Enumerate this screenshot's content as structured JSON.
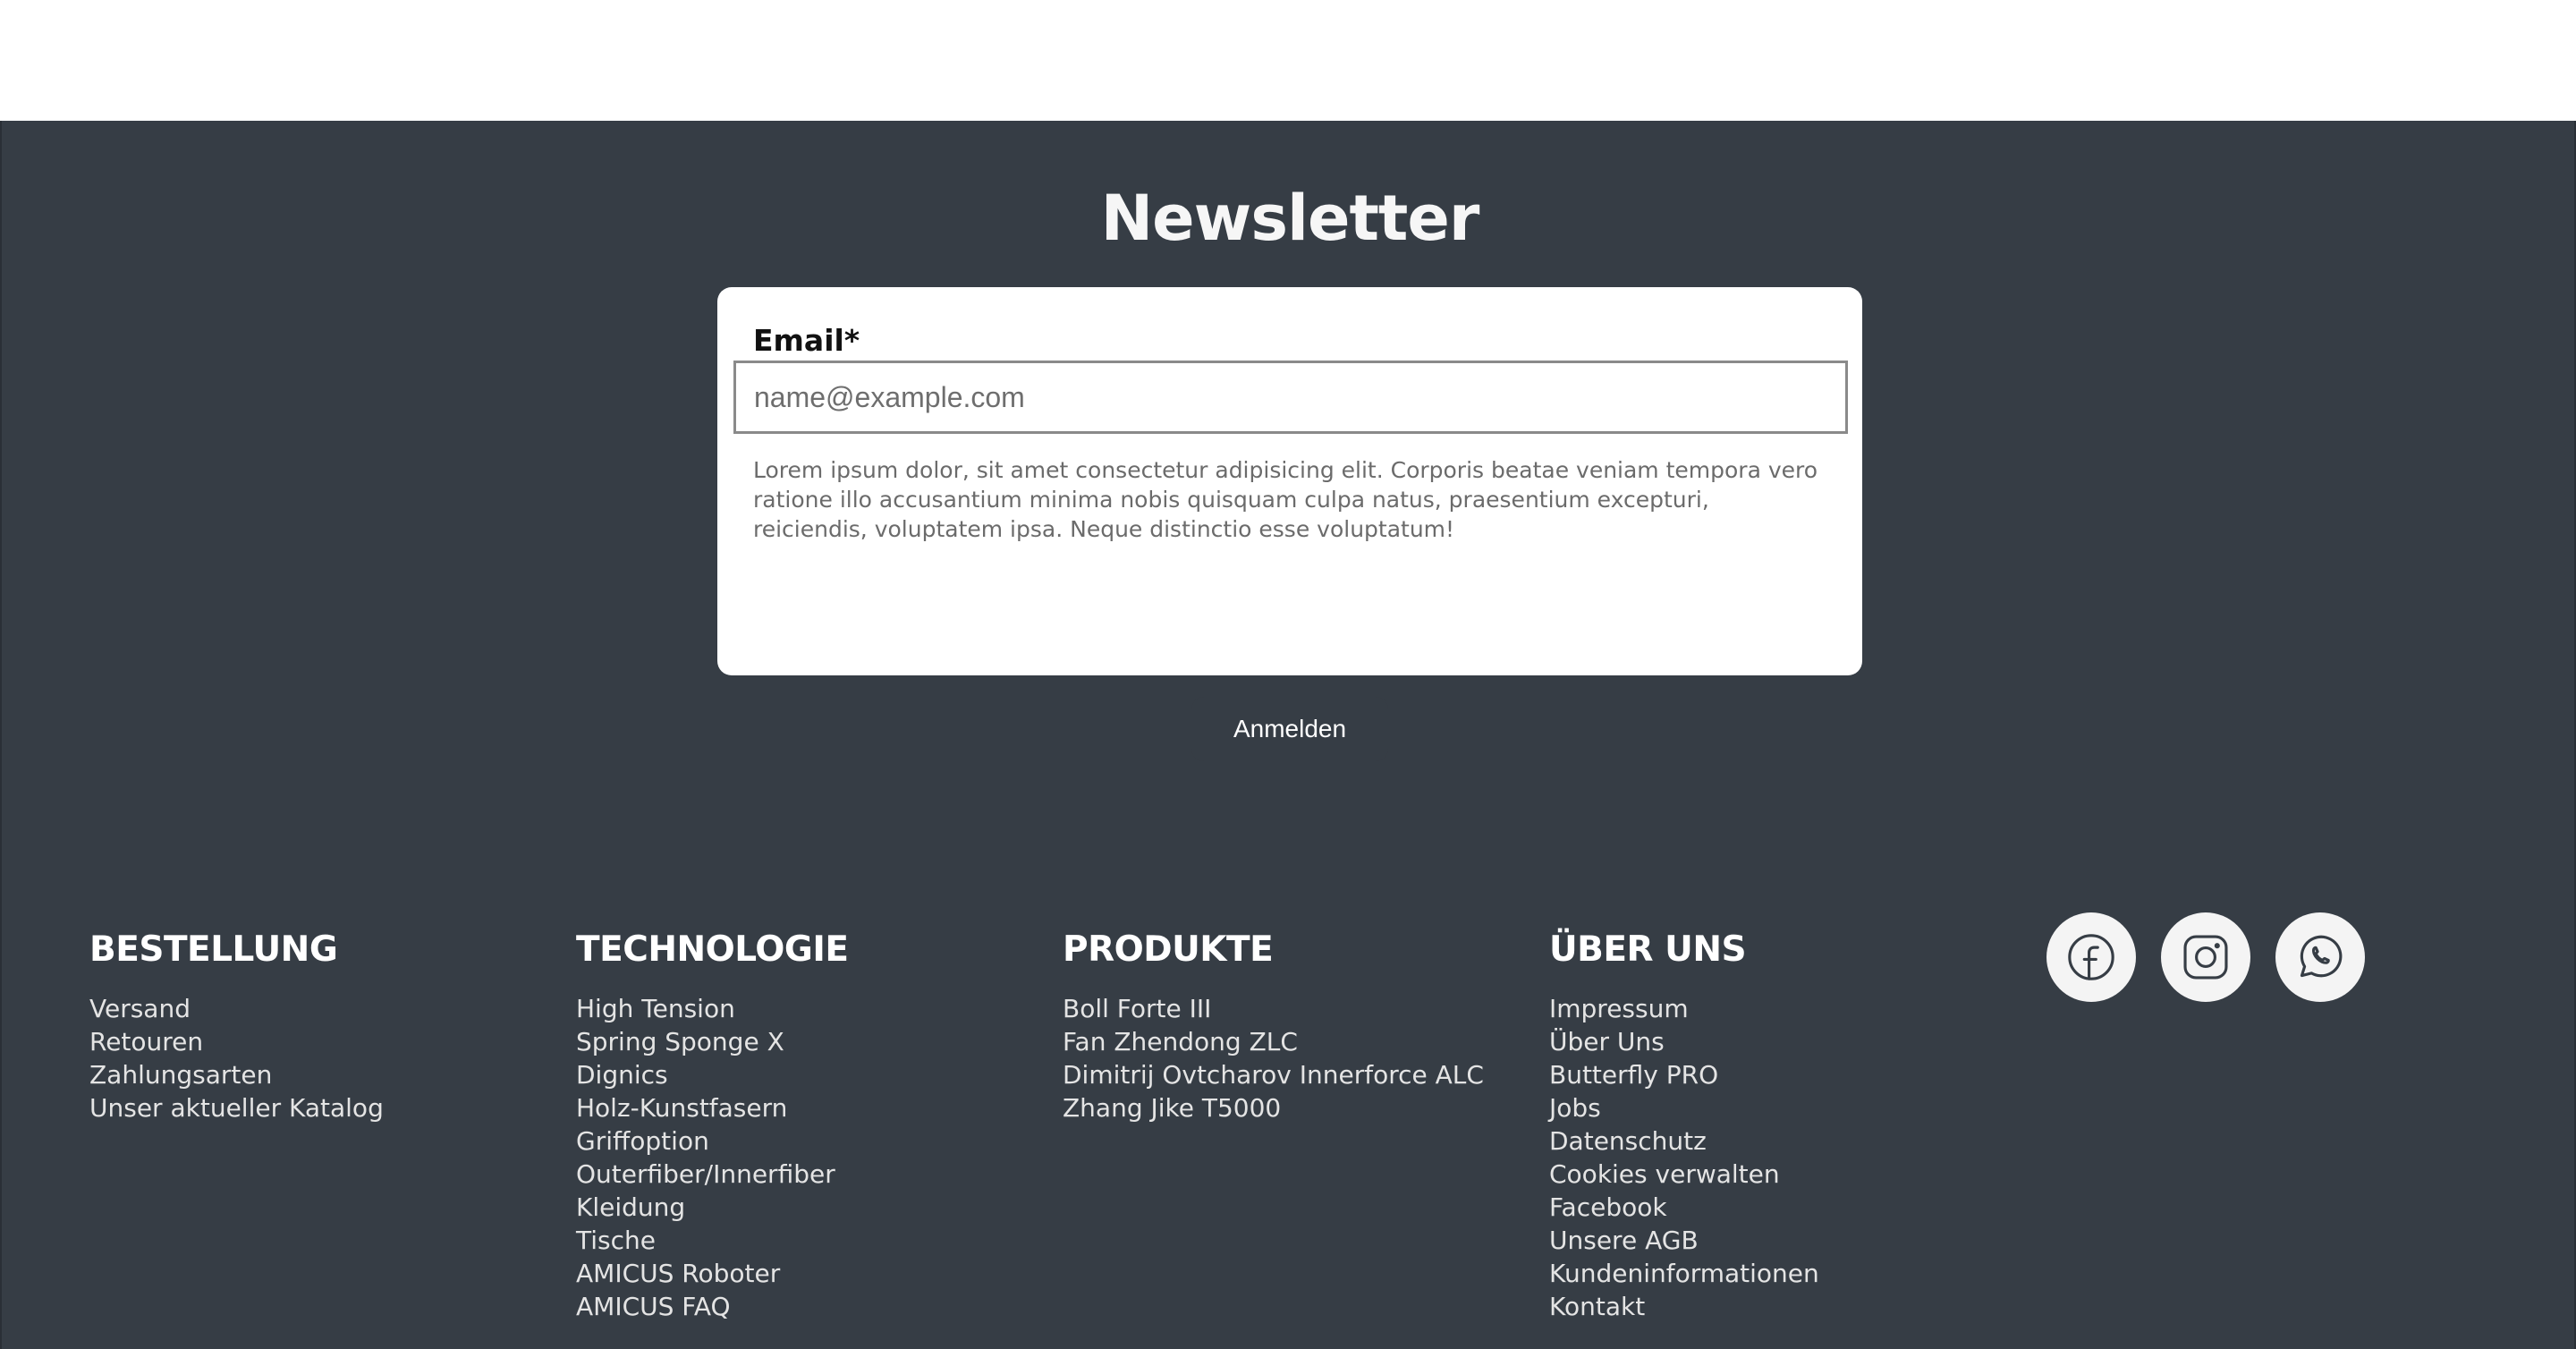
{
  "newsletter": {
    "title": "Newsletter",
    "email_label": "Email*",
    "email_placeholder": "name@example.com",
    "email_value": "",
    "disclaimer": "Lorem ipsum dolor, sit amet consectetur adipisicing elit. Corporis beatae veniam tempora vero ratione illo accusantium minima nobis quisquam culpa natus, praesentium excepturi, reiciendis, voluptatem ipsa. Neque distinctio esse voluptatum!",
    "submit_label": "Anmelden"
  },
  "columns": [
    {
      "heading": "BESTELLUNG",
      "items": [
        "Versand",
        "Retouren",
        "Zahlungsarten",
        "Unser aktueller Katalog"
      ]
    },
    {
      "heading": "TECHNOLOGIE",
      "items": [
        "High Tension",
        "Spring Sponge X",
        "Dignics",
        "Holz-Kunstfasern",
        "Griffoption",
        "Outerfiber/Innerfiber",
        "Kleidung",
        "Tische",
        "AMICUS Roboter",
        "AMICUS FAQ"
      ]
    },
    {
      "heading": "PRODUKTE",
      "items": [
        "Boll Forte III",
        "Fan Zhendong ZLC",
        "Dimitrij Ovtcharov Innerforce ALC",
        "Zhang Jike T5000"
      ]
    },
    {
      "heading": "ÜBER UNS",
      "items": [
        "Impressum",
        "Über Uns",
        "Butterfly PRO",
        "Jobs",
        "Datenschutz",
        "Cookies verwalten",
        "Facebook",
        "Unsere AGB",
        "Kundeninformationen",
        "Kontakt"
      ]
    }
  ],
  "socials": [
    {
      "icon": "facebook-icon"
    },
    {
      "icon": "instagram-icon"
    },
    {
      "icon": "whatsapp-icon"
    }
  ],
  "colors": {
    "footer_bg": "#363d45",
    "card_bg": "#ffffff",
    "button_bg": "#363d45"
  }
}
